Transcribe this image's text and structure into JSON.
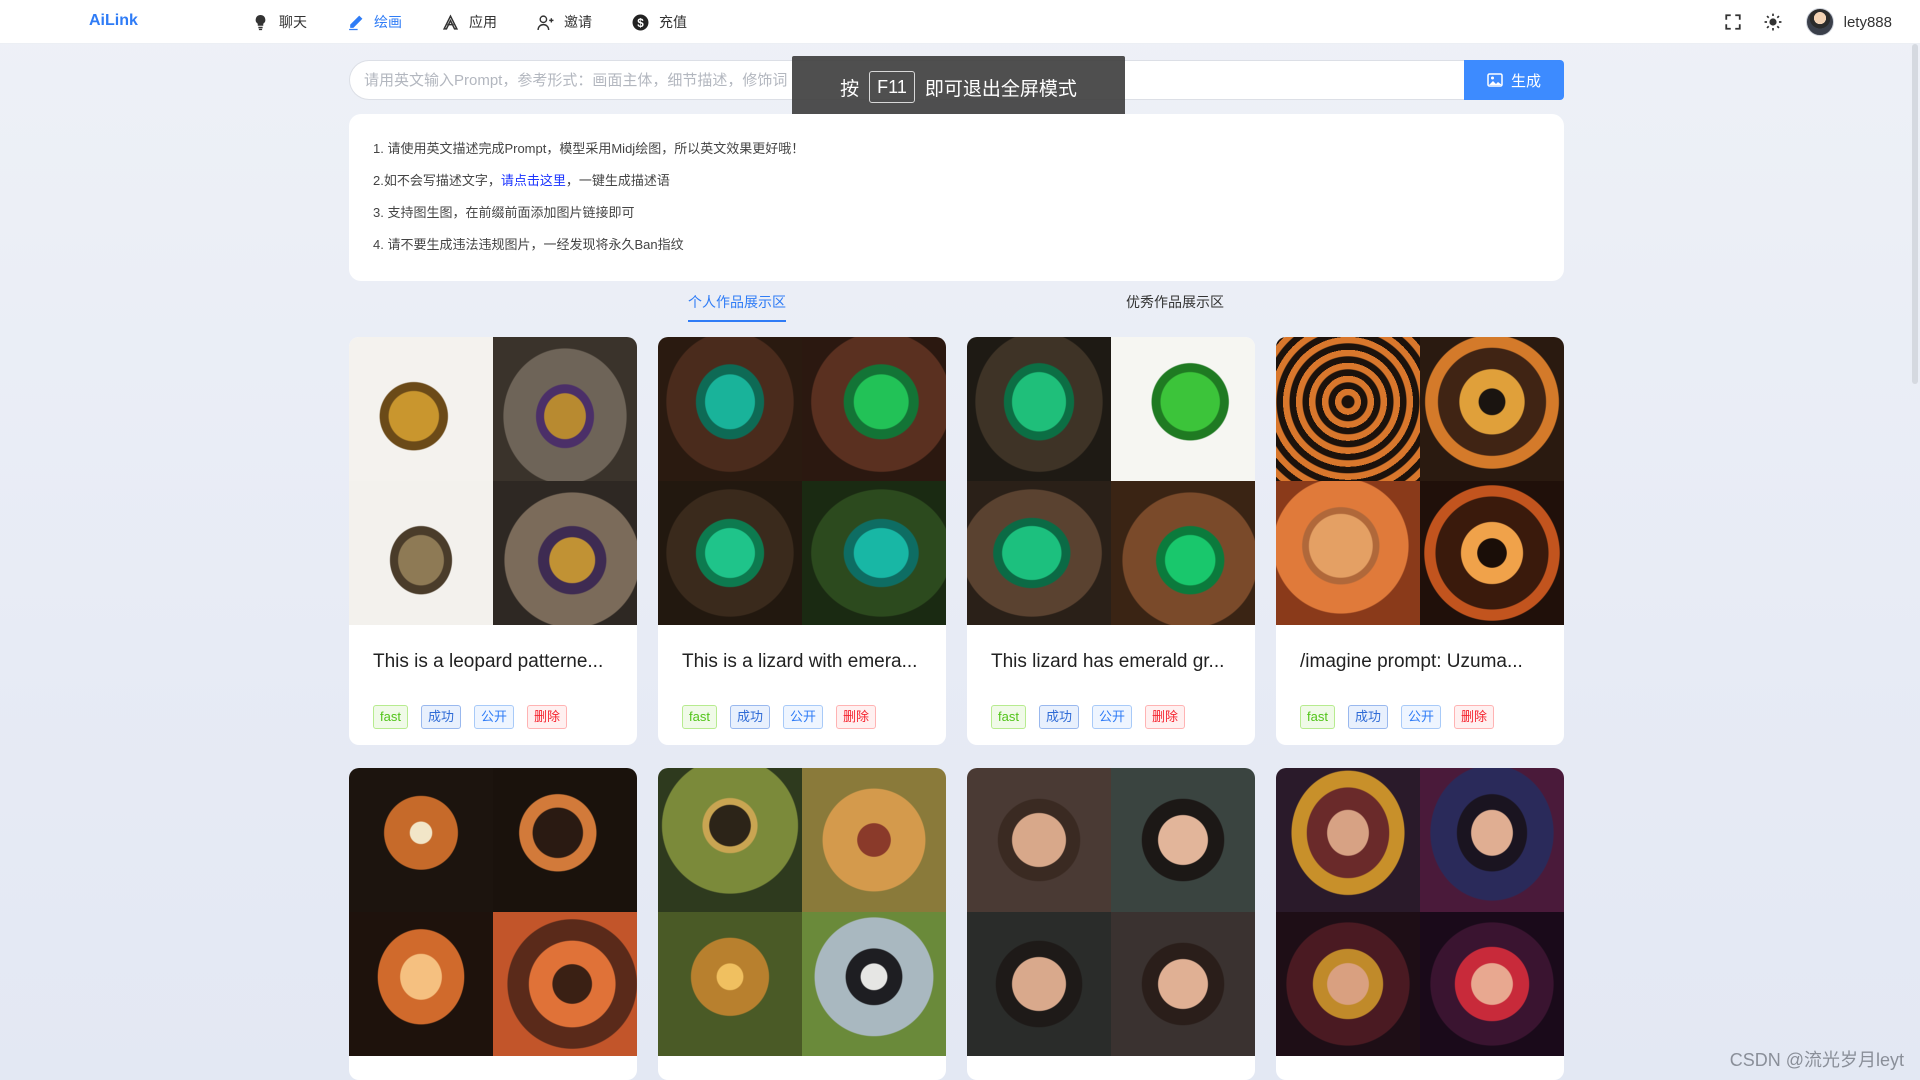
{
  "brand": "AiLink",
  "nav": [
    {
      "label": "聊天",
      "icon": "bulb-icon",
      "active": false
    },
    {
      "label": "绘画",
      "icon": "pencil-icon",
      "active": true
    },
    {
      "label": "应用",
      "icon": "apps-icon",
      "active": false
    },
    {
      "label": "邀请",
      "icon": "invite-user-icon",
      "active": false
    },
    {
      "label": "充值",
      "icon": "dollar-icon",
      "active": false
    }
  ],
  "user": {
    "name": "lety888"
  },
  "prompt": {
    "placeholder": "请用英文输入Prompt，参考形式：画面主体，细节描述，修饰词",
    "value": "",
    "button": "生成"
  },
  "toast": {
    "prefix": "按",
    "key": "F11",
    "suffix": "即可退出全屏模式"
  },
  "info": {
    "line1": "1. 请使用英文描述完成Prompt，模型采用Midj绘图，所以英文效果更好哦！",
    "line2_before": "2.如不会写描述文字，",
    "line2_link": "请点击这里",
    "line2_after": "，一键生成描述语",
    "line3": "3. 支持图生图，在前缀前面添加图片链接即可",
    "line4": "4. 请不要生成违法违规图片，一经发现将永久Ban指纹"
  },
  "tabs": {
    "personal": "个人作品展示区",
    "featured": "优秀作品展示区"
  },
  "tag_labels": {
    "fast": "fast",
    "ok": "成功",
    "pub": "公开",
    "del": "删除"
  },
  "cards": [
    {
      "title": "This is a leopard patterne..."
    },
    {
      "title": "This is a lizard with emera..."
    },
    {
      "title": "This lizard has emerald gr..."
    },
    {
      "title": "/imagine prompt: Uzuma..."
    }
  ],
  "watermark": "CSDN @流光岁月leyt",
  "colors": {
    "accent": "#2f7cf6",
    "button": "#3d8bff",
    "danger": "#f5222d",
    "success": "#52c41a"
  }
}
